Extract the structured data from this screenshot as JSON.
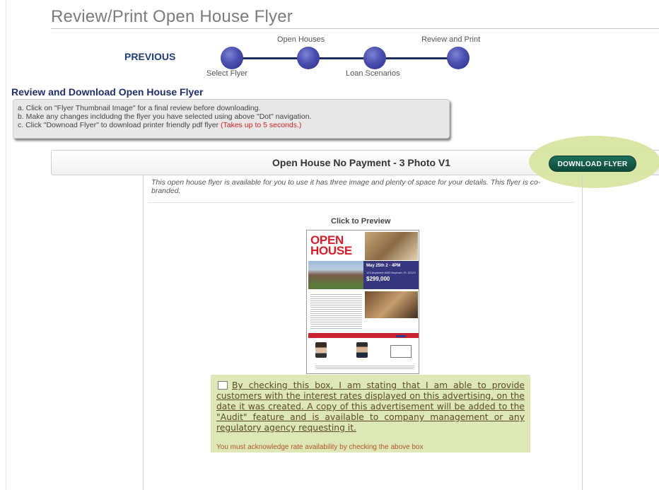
{
  "page": {
    "title": "Review/Print Open House Flyer"
  },
  "nav": {
    "previous_label": "PREVIOUS",
    "steps": [
      {
        "label": "Select Flyer"
      },
      {
        "label": "Open Houses"
      },
      {
        "label": "Loan Scenarios"
      },
      {
        "label": "Review and Print"
      }
    ],
    "current_step": 4
  },
  "section": {
    "heading": "Review and Download Open House Flyer"
  },
  "instructions": {
    "line_a": "a. Click on \"Flyer Thumbnail Image\" for a final review before downloading.",
    "line_b": "b. Make any changes incldudng the flyer you have selected using above \"Dot\" navigation.",
    "line_c": "c. Click \"Downoad Flyer\" to download printer friendly pdf flyer ",
    "line_c_note": "(Takes up to 5 seconds.)"
  },
  "flyer": {
    "name": "Open House No Payment - 3 Photo V1",
    "download_label": "DOWNLOAD FLYER",
    "description": "This open house flyer is available for you to use it has three image and plenty of space for your details. This flyer is co-branded.",
    "preview_label": "Click to Preview",
    "thumbnail": {
      "headline_1": "OPEN",
      "headline_2": "HOUSE",
      "date": "May 25th  2 - 4PM",
      "address": "123 Anystreet #000 Anytown, FL 32123",
      "price": "$299,000"
    }
  },
  "acknowledgement": {
    "text": "By checking this box, I am stating that I am able to provide customers with the interest rates displayed on this advertising, on the date it was created. A copy of this advertisement will be added to the \"Audit\" feature and is available to company management or any regulatory agency requesting it.",
    "warning": "You must acknowledge rate availability by checking the above box",
    "checked": false
  },
  "colors": {
    "nav_dot": "#3f43a3",
    "download_button": "#0f5443",
    "highlight": "#d7e5a0",
    "ack_background": "#dee8b6"
  }
}
